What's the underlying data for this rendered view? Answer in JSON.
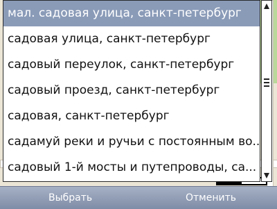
{
  "suggestions": [
    "мал. садовая улица, санкт-петербург",
    "садовая улица, санкт-петербург",
    "садовый переулок, санкт-петербург",
    "садовый проезд, санкт-петербург",
    "садовая, санкт-петербург",
    "садамуй реки и ручьи с постоянным во...",
    "садовый 1-й мосты и путепроводы, са..."
  ],
  "selected_index": 0,
  "softkeys": {
    "left_label": "Выбрать",
    "right_label": "Отменить"
  },
  "colors": {
    "selection": "#8a9bb8",
    "softkey_bar": "#8f9bb3"
  }
}
